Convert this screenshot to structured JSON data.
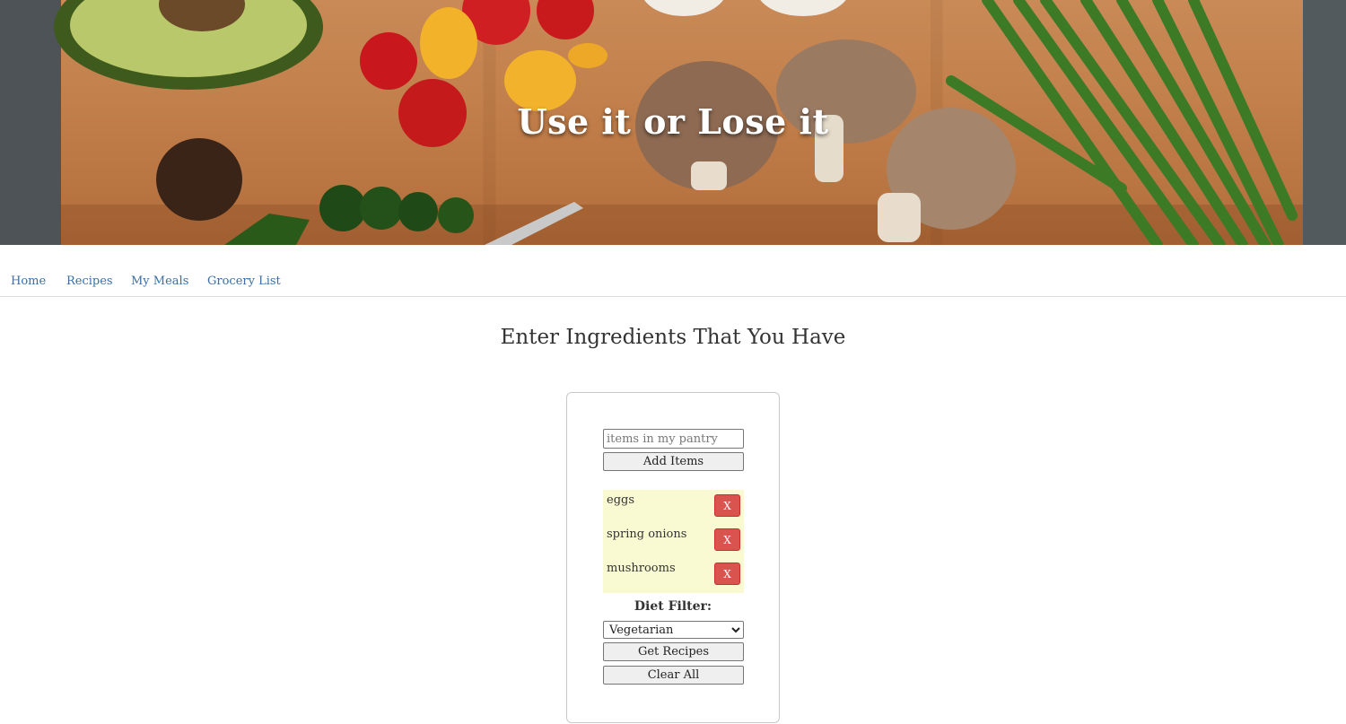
{
  "hero": {
    "title": "Use it or Lose it"
  },
  "nav": {
    "items": [
      {
        "label": "Home"
      },
      {
        "label": "Recipes"
      },
      {
        "label": "My Meals"
      },
      {
        "label": "Grocery List"
      }
    ]
  },
  "main": {
    "heading": "Enter Ingredients That You Have",
    "pantry_input": {
      "placeholder": "items in my pantry",
      "value": ""
    },
    "add_button": "Add Items",
    "ingredients": [
      {
        "name": "eggs",
        "remove_label": "X"
      },
      {
        "name": "spring onions",
        "remove_label": "X"
      },
      {
        "name": "mushrooms",
        "remove_label": "X"
      }
    ],
    "diet_filter": {
      "label": "Diet Filter:",
      "selected": "Vegetarian"
    },
    "get_recipes_button": "Get Recipes",
    "clear_all_button": "Clear All"
  },
  "colors": {
    "nav_link": "#3a6ea5",
    "list_background": "#fafad2",
    "remove_button": "#d9534f"
  }
}
